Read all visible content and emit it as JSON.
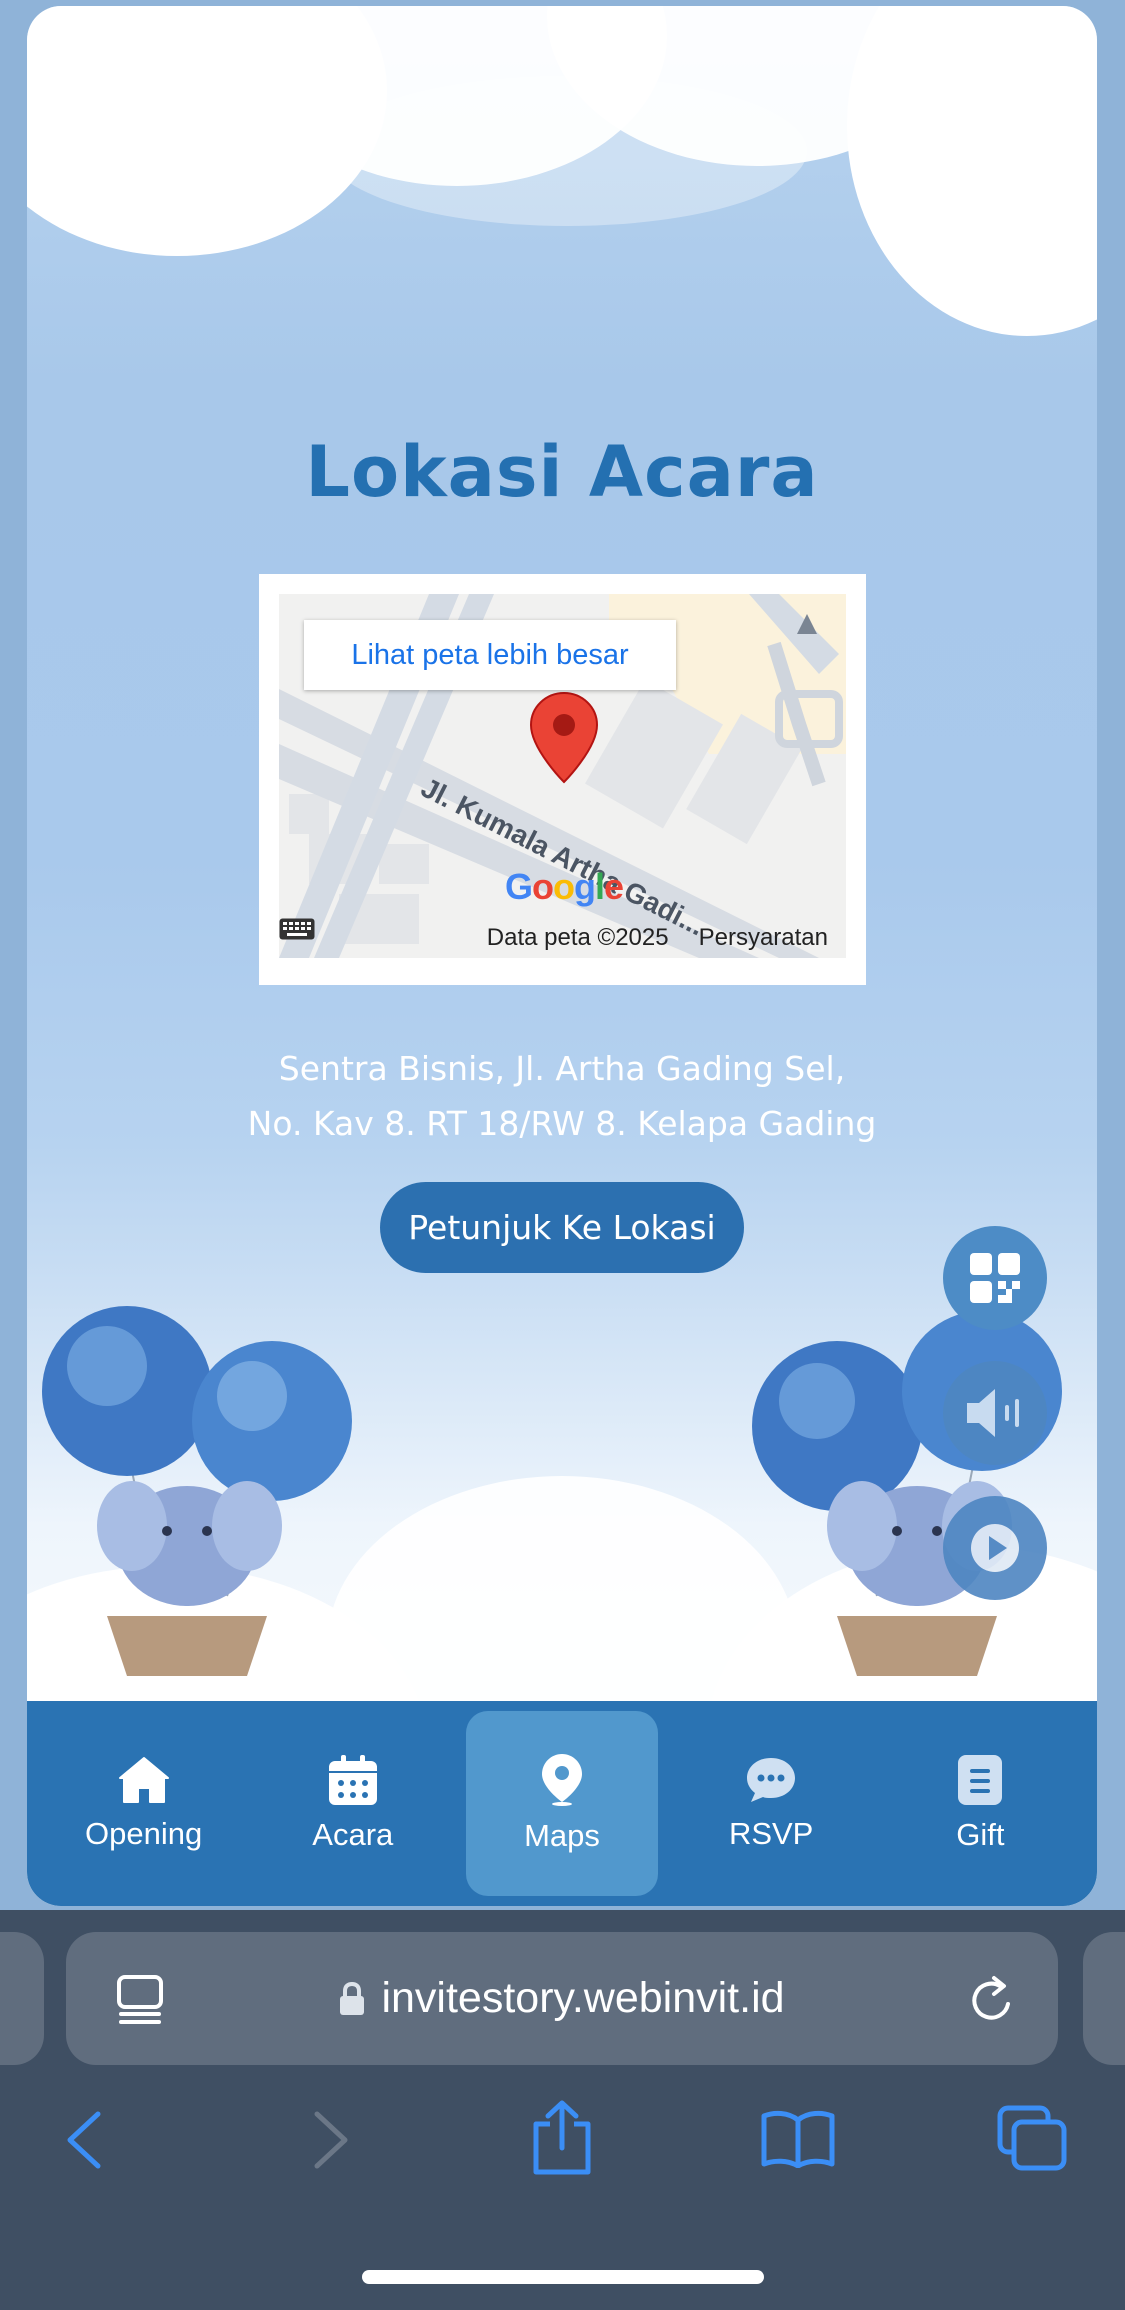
{
  "section": {
    "title": "Lokasi Acara"
  },
  "map": {
    "link_label": "Lihat peta lebih besar",
    "street_label": "Jl. Kumala Artha Gadi...",
    "logo_text": "Google",
    "data_label": "Data peta ©2025",
    "terms_label": "Persyaratan"
  },
  "address": {
    "line1": "Sentra Bisnis, Jl. Artha Gading Sel,",
    "line2": "No. Kav 8. RT 18/RW 8. Kelapa Gading"
  },
  "directions_button": "Petunjuk Ke Lokasi",
  "floating_buttons": [
    "qr-code-icon",
    "speaker-icon",
    "play-icon"
  ],
  "nav": {
    "items": [
      {
        "label": "Opening",
        "icon": "home-icon",
        "active": false
      },
      {
        "label": "Acara",
        "icon": "calendar-icon",
        "active": false
      },
      {
        "label": "Maps",
        "icon": "map-pin-icon",
        "active": true
      },
      {
        "label": "RSVP",
        "icon": "chat-icon",
        "active": false
      },
      {
        "label": "Gift",
        "icon": "gift-icon",
        "active": false
      }
    ]
  },
  "browser": {
    "url": "invitestory.webinvit.id"
  },
  "colors": {
    "accent": "#2a73b3",
    "title": "#2470b1",
    "nav_active": "#5198cd",
    "browser_chrome": "#3f4f63"
  }
}
